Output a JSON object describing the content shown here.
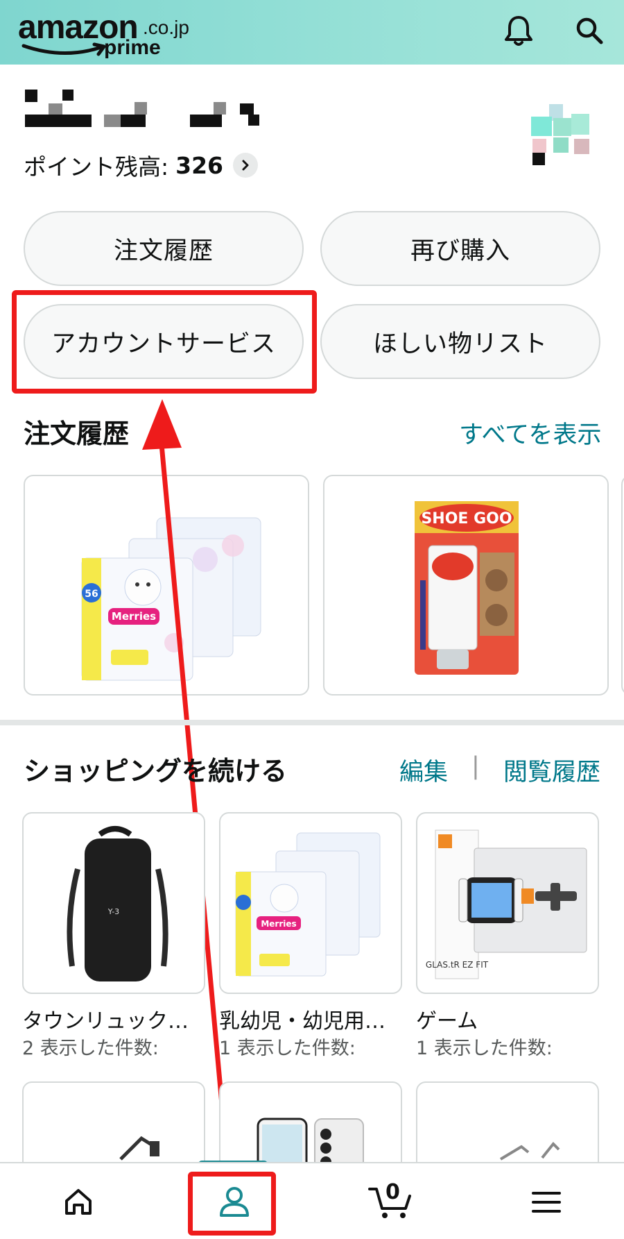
{
  "header": {
    "logo_word": "amazon",
    "logo_tld": ".co.jp",
    "logo_prime": "prime",
    "icons": [
      "bell-icon",
      "search-icon"
    ]
  },
  "account": {
    "points_label": "ポイント残高:",
    "points_value": "326"
  },
  "quick_buttons": [
    {
      "label": "注文履歴"
    },
    {
      "label": "再び購入"
    },
    {
      "label": "アカウントサービス"
    },
    {
      "label": "ほしい物リスト"
    }
  ],
  "orders": {
    "title": "注文履歴",
    "view_all": "すべてを表示",
    "items": [
      {
        "label": "Merries"
      },
      {
        "label": "SHOE GOO"
      }
    ]
  },
  "continue_shopping": {
    "title": "ショッピングを続ける",
    "edit": "編集",
    "separator": "|",
    "history": "閲覧履歴",
    "items": [
      {
        "name": "タウンリュック…",
        "count": "2 表示した件数:",
        "label": "Y-3"
      },
      {
        "name": "乳幼児・幼児用…",
        "count": "1 表示した件数:",
        "label": "Merries"
      },
      {
        "name": "ゲーム",
        "count": "1 表示した件数:",
        "label": "GLAS.tR EZ FIT"
      }
    ]
  },
  "bottom_nav": {
    "items": [
      "home-icon",
      "account-icon",
      "cart-icon",
      "menu-icon"
    ],
    "cart_count": "0"
  },
  "colors": {
    "header_start": "#7fd6cf",
    "header_end": "#a6e6da",
    "link": "#00788a",
    "annotation": "#ee1b1b"
  }
}
